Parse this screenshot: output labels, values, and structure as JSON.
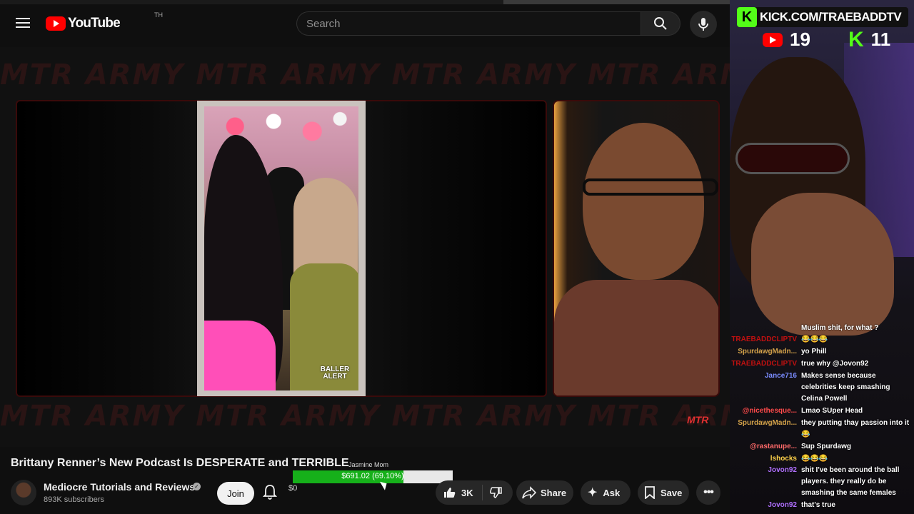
{
  "youtube": {
    "brand": "YouTube",
    "country": "TH",
    "search_placeholder": "Search",
    "watermark_text": "MTR ARMY   MTR ARMY   MTR ARMY   MTR ARMY   MTR ARMY",
    "reel_watermark": "BALLER ALERT",
    "corner_logo": "MTR",
    "video_title": "Brittany Renner’s New Podcast Is DESPERATE and TERRIBLE",
    "channel_name": "Mediocre Tutorials and Reviews",
    "subscribers": "893K subscribers",
    "join_label": "Join",
    "superchat_amount": "$0",
    "goal": {
      "label": "Jasmine Mom",
      "text": "$691.02 (69.10%)",
      "progress": 0.691
    },
    "likes": "3K",
    "share_label": "Share",
    "ask_label": "Ask",
    "save_label": "Save"
  },
  "stream": {
    "kick_url": "KICK.COM/TRAEBADDTV",
    "kick_badge": "K",
    "youtube_viewers": "19",
    "kick_viewers": "11",
    "kick_letter": "K",
    "chat": [
      {
        "user": "",
        "text": "Muslim shit, for what ?",
        "color": "#ffffff"
      },
      {
        "user": "TRAEBADDCLIPTV",
        "text": "😂😂😂",
        "color": "#c01010"
      },
      {
        "user": "SpurdawgMadn...",
        "text": "yo Phill",
        "color": "#d4a24a"
      },
      {
        "user": "TRAEBADDCLIPTV",
        "text": "true why @Jovon92",
        "color": "#c01010"
      },
      {
        "user": "Jance716",
        "text": "Makes sense because celebrities keep smashing Celina Powell",
        "color": "#7a8cff"
      },
      {
        "user": "@nicethesque...",
        "text": "Lmao SUper Head",
        "color": "#ff4a4a"
      },
      {
        "user": "SpurdawgMadn...",
        "text": "they putting thay passion into it 😂",
        "color": "#d4a24a"
      },
      {
        "user": "@rastanupe...",
        "text": "Sup Spurdawg",
        "color": "#ff6a6a"
      },
      {
        "user": "lshocks",
        "text": "😂😂😂",
        "color": "#ffd24a"
      },
      {
        "user": "Jovon92",
        "text": "shit I've been around the ball players. they really do be smashing the same females",
        "color": "#b070ff"
      },
      {
        "user": "Jovon92",
        "text": "that's true",
        "color": "#b070ff"
      }
    ]
  }
}
